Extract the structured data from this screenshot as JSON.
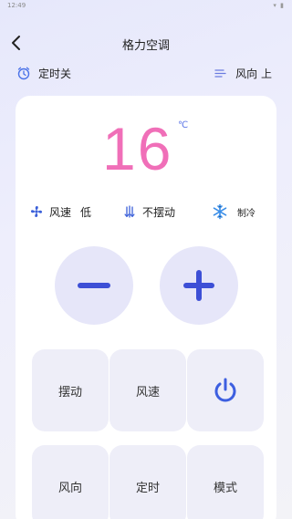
{
  "status_bar": {
    "time": "12:49",
    "icons": "▾ ▮"
  },
  "header": {
    "title": "格力空调"
  },
  "top_actions": {
    "timer_label": "定时关",
    "wind_label": "风向 上"
  },
  "display": {
    "temperature": "16",
    "unit": "℃"
  },
  "info": {
    "fan_label": "风速",
    "fan_value": "低",
    "swing_label": "不摆动",
    "mode_label": "制冷"
  },
  "controls": {
    "swing": "摆动",
    "fan_speed": "风速",
    "direction": "风向",
    "timer": "定时",
    "mode": "模式"
  },
  "colors": {
    "accent": "#3d4fd6",
    "temperature": "#f06fb8"
  }
}
